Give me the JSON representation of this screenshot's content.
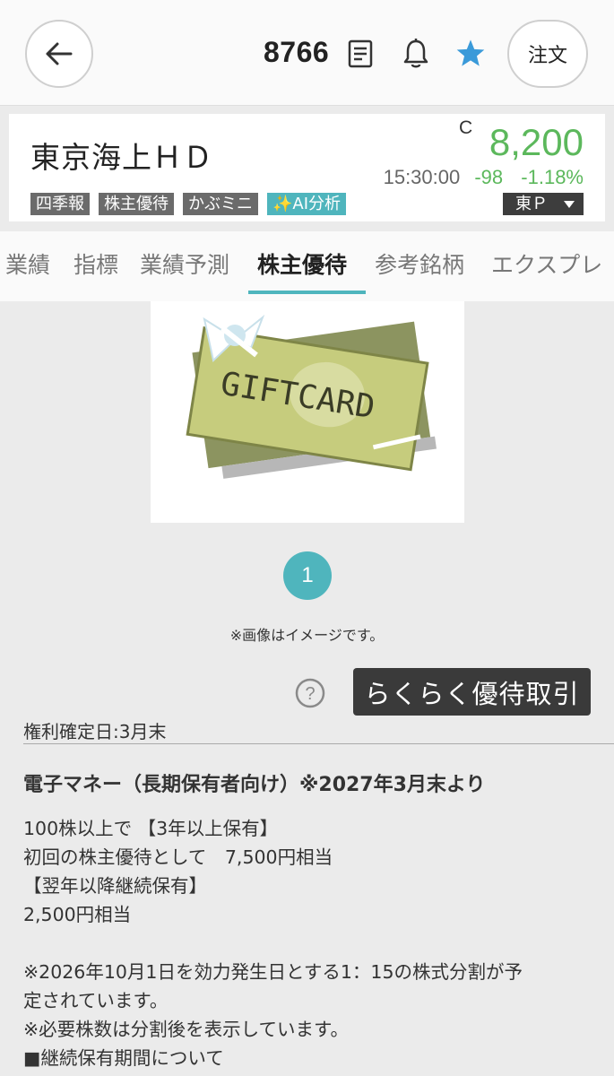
{
  "header": {
    "stock_code": "8766",
    "order_label": "注文"
  },
  "stock": {
    "name": "東京海上ＨＤ",
    "close_mark": "C",
    "price": "8,200",
    "time": "15:30:00",
    "change": "-98",
    "change_pct": "-1.18%",
    "tags": [
      "四季報",
      "株主優待",
      "かぶミニ",
      "✨AI分析"
    ],
    "exchange": "東Ｐ"
  },
  "tabs": [
    "業績",
    "指標",
    "業績予測",
    "株主優待",
    "参考銘柄",
    "エクスプレ"
  ],
  "active_tab": "株主優待",
  "gallery": {
    "image_text": "GIFTCARD",
    "page_indicator": "1",
    "note": "※画像はイメージです。"
  },
  "actions": {
    "rakuraku_label": "らくらく優待取引",
    "help_symbol": "?"
  },
  "benefit": {
    "record_date": "権利確定日:3月末",
    "title": "電子マネー（長期保有者向け）※2027年3月末より",
    "lines": [
      "100株以上で 【3年以上保有】",
      "初回の株主優待として　7,500円相当",
      "【翌年以降継続保有】",
      "2,500円相当",
      "",
      "※2026年10月1日を効力発生日とする1：15の株式分割が予",
      "定されています。",
      "※必要株数は分割後を表示しています。",
      "■継続保有期間について"
    ]
  },
  "colors": {
    "accent": "#4fb5bd",
    "price_green": "#5cb85c",
    "tag_gray": "#6b6b6b"
  }
}
